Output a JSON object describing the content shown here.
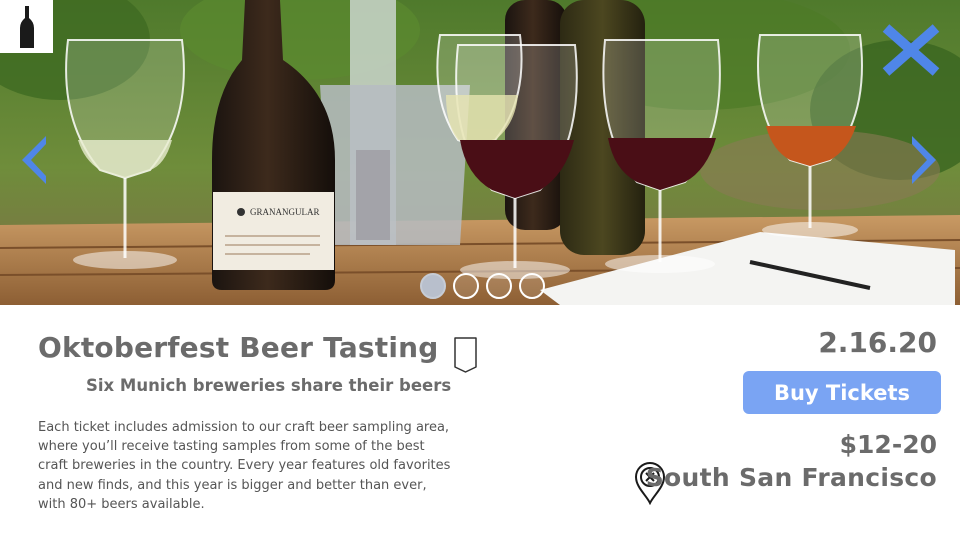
{
  "hero": {
    "image": "wine-tasting-table-photo",
    "active_slide": 1,
    "slide_count": 4,
    "icons": {
      "logo": "wine-bottle-icon",
      "close": "close-x-icon",
      "prev": "chevron-left-icon",
      "next": "chevron-right-icon"
    }
  },
  "event": {
    "title": "Oktoberfest Beer Tasting",
    "subtitle": "Six Munich breweries share their beers",
    "description": "Each ticket includes admission to our craft beer sampling area, where you’ll receive tasting samples from some of the best craft breweries in the country. Every year features old favorites and new finds, and this year is bigger and better than ever, with 80+ beers available.",
    "bookmark_icon": "bookmark-icon",
    "date": "2.16.20",
    "buy_label": "Buy Tickets",
    "price": "$12-20",
    "location": "South San Francisco",
    "location_icon": "map-pin-icon"
  },
  "colors": {
    "accent": "#7aa4f3",
    "icon_blue": "#4f86e8",
    "text": "#6b6b6b"
  }
}
